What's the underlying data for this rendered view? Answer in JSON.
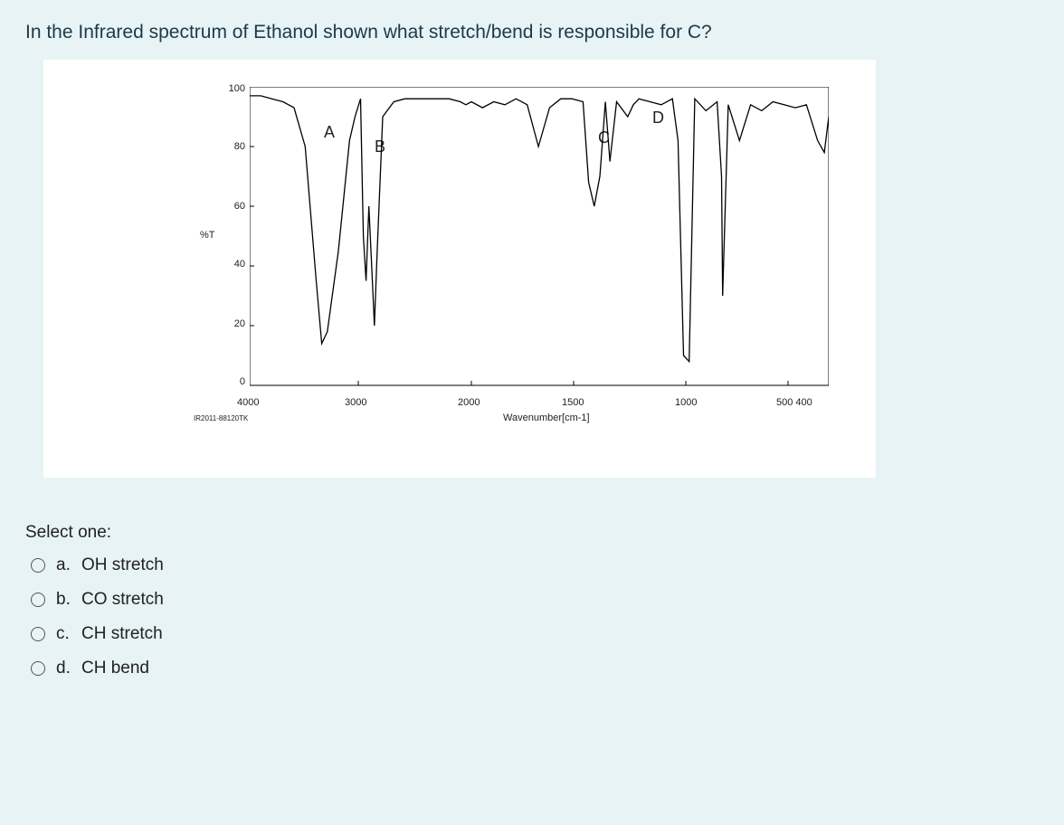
{
  "question": "In the Infrared spectrum of Ethanol shown what stretch/bend is responsible for C?",
  "select_label": "Select one:",
  "options": [
    {
      "letter": "a.",
      "text": "OH stretch"
    },
    {
      "letter": "b.",
      "text": "CO stretch"
    },
    {
      "letter": "c.",
      "text": "CH stretch"
    },
    {
      "letter": "d.",
      "text": "CH bend"
    }
  ],
  "chart_data": {
    "type": "line",
    "title": "",
    "xlabel": "Wavenumber[cm-1]",
    "ylabel": "%T",
    "footnote": "IR2011-88120TK",
    "y_ticks": [
      "100",
      "80",
      "60",
      "40",
      "20",
      "0"
    ],
    "x_ticks": [
      "4000",
      "3000",
      "2000",
      "1500",
      "1000",
      "500 400"
    ],
    "ylim": [
      0,
      100
    ],
    "peak_annotations": [
      {
        "label": "A",
        "approx_x": 3500,
        "approx_y": 84
      },
      {
        "label": "B",
        "approx_x": 3000,
        "approx_y": 80
      },
      {
        "label": "C",
        "approx_x": 1500,
        "approx_y": 82
      },
      {
        "label": "D",
        "approx_x": 1250,
        "approx_y": 92
      }
    ],
    "series": [
      {
        "name": "Ethanol IR %T",
        "x": [
          4000,
          3900,
          3800,
          3700,
          3600,
          3500,
          3400,
          3350,
          3300,
          3200,
          3100,
          3050,
          3000,
          2975,
          2950,
          2925,
          2900,
          2875,
          2850,
          2800,
          2700,
          2600,
          2500,
          2400,
          2300,
          2200,
          2100,
          2050,
          2000,
          1950,
          1900,
          1850,
          1800,
          1750,
          1700,
          1650,
          1600,
          1550,
          1500,
          1475,
          1450,
          1425,
          1400,
          1380,
          1350,
          1300,
          1275,
          1250,
          1200,
          1150,
          1100,
          1075,
          1050,
          1025,
          1000,
          950,
          900,
          880,
          875,
          850,
          800,
          750,
          700,
          650,
          600,
          550,
          500,
          450,
          420,
          400
        ],
        "y": [
          97,
          97,
          96,
          95,
          93,
          80,
          35,
          14,
          18,
          45,
          82,
          90,
          96,
          50,
          35,
          60,
          40,
          20,
          45,
          90,
          95,
          96,
          96,
          96,
          96,
          96,
          95,
          94,
          95,
          93,
          95,
          94,
          96,
          94,
          80,
          93,
          96,
          96,
          95,
          68,
          60,
          70,
          95,
          75,
          95,
          90,
          94,
          96,
          95,
          94,
          96,
          82,
          10,
          8,
          96,
          92,
          95,
          70,
          30,
          94,
          82,
          94,
          92,
          95,
          94,
          93,
          94,
          82,
          78,
          90
        ]
      }
    ]
  }
}
